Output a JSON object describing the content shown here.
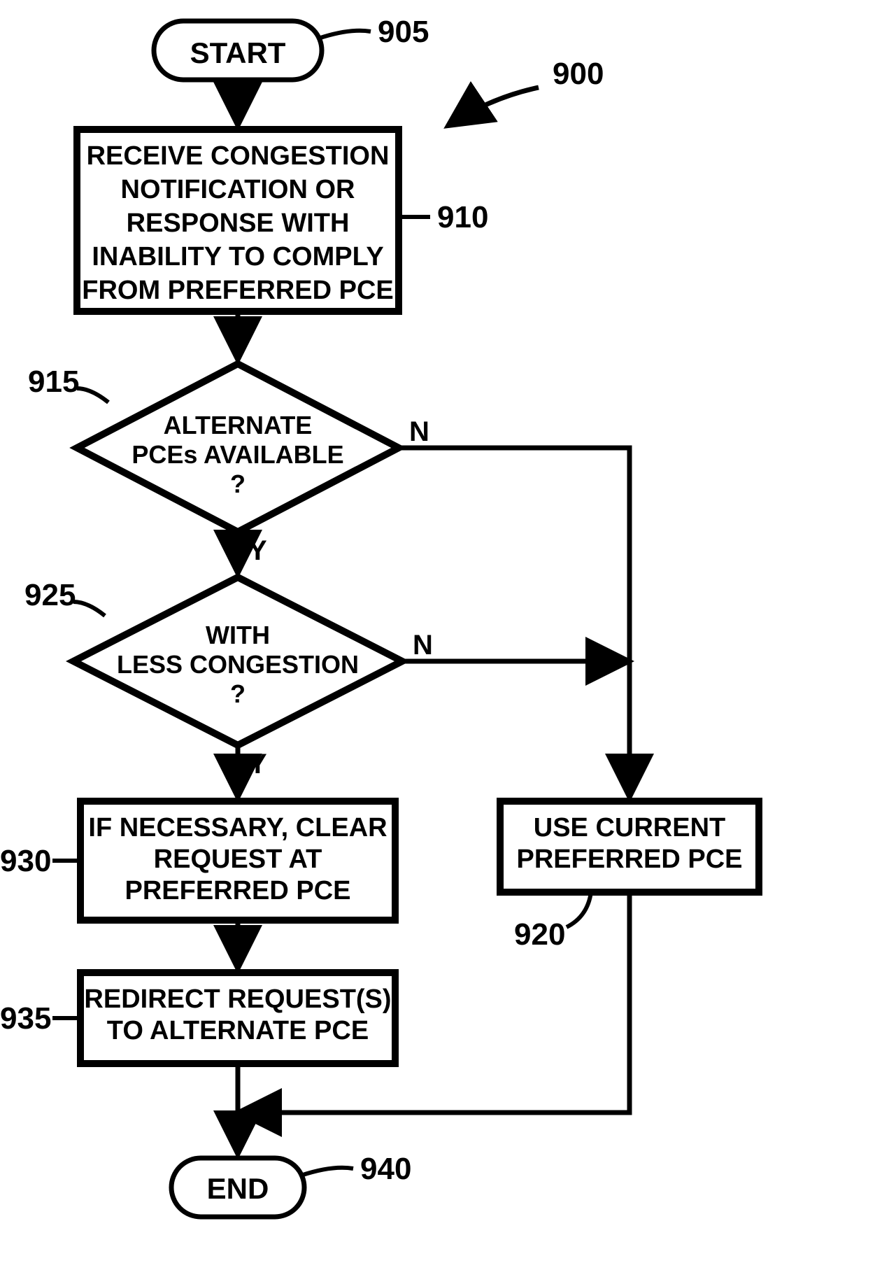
{
  "figure_ref": "900",
  "nodes": {
    "start": {
      "ref": "905",
      "text": "START"
    },
    "receive": {
      "ref": "910",
      "lines": [
        "RECEIVE CONGESTION",
        "NOTIFICATION OR",
        "RESPONSE WITH",
        "INABILITY TO COMPLY",
        "FROM PREFERRED PCE"
      ]
    },
    "alt": {
      "ref": "915",
      "lines": [
        "ALTERNATE",
        "PCEs AVAILABLE",
        "?"
      ],
      "yes": "Y",
      "no": "N"
    },
    "less": {
      "ref": "925",
      "lines": [
        "WITH",
        "LESS CONGESTION",
        "?"
      ],
      "yes": "Y",
      "no": "N"
    },
    "clear": {
      "ref": "930",
      "lines": [
        "IF NECESSARY, CLEAR",
        "REQUEST AT",
        "PREFERRED PCE"
      ]
    },
    "redirect": {
      "ref": "935",
      "lines": [
        "REDIRECT REQUEST(S)",
        "TO ALTERNATE PCE"
      ]
    },
    "useCur": {
      "ref": "920",
      "lines": [
        "USE CURRENT",
        "PREFERRED PCE"
      ]
    },
    "end": {
      "ref": "940",
      "text": "END"
    }
  }
}
